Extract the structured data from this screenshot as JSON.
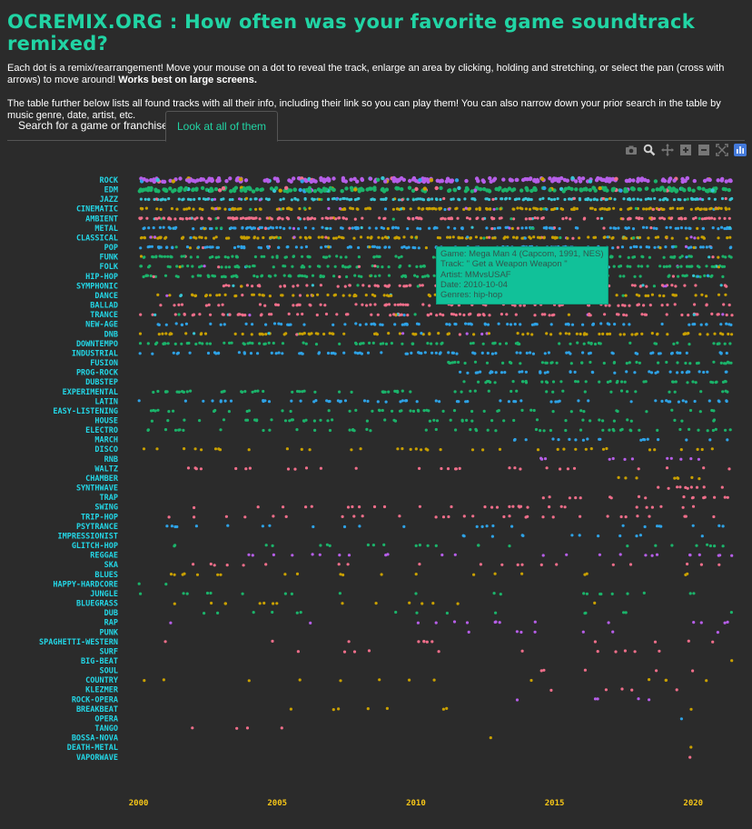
{
  "page": {
    "title": "OCREMIX.ORG : How often was your favorite game soundtrack remixed?",
    "intro1_text": "Each dot is a remix/rearrangement! Move your mouse on a dot to reveal the track, enlarge an area by clicking, holding and stretching, or select the pan (cross with arrows) to move around! ",
    "intro1_bold": "Works best on large screens.",
    "intro2": "The table further below lists all found tracks with all their info, including their link so you can play them! You can also narrow down your prior search in the table by music genre, date, artist, etc."
  },
  "tabs": [
    {
      "label": "Search for a game or franchise",
      "active": false
    },
    {
      "label": "Look at all of them",
      "active": true
    }
  ],
  "modebar": [
    "camera-icon",
    "zoom-icon",
    "pan-icon",
    "zoom-in-icon",
    "zoom-out-icon",
    "autoscale-icon",
    "plotly-logo-icon"
  ],
  "tooltip": {
    "game": "Game: Mega Man 4 (Capcom, 1991, NES)",
    "track": "Track: \" Get a Weapon Weapon \"",
    "artist": "Artist: MMvsUSAF",
    "date": "Date: 2010-10-04",
    "genres": "Genres: hip-hop"
  },
  "chart_data": {
    "type": "scatter",
    "xlabel": "",
    "ylabel": "",
    "x_ticks": [
      "2000",
      "2005",
      "2010",
      "2015",
      "2020"
    ],
    "xlim": [
      1999.85,
      2021.4
    ],
    "grid": false,
    "genre_colors": [
      "#36c4d4",
      "#36c4d4",
      "#f06e8a",
      "#c9a000",
      "#1bb36a",
      "#2ea2e6",
      "#b65ee8",
      "#c9a000",
      "#f06e8a",
      "#1bb36a"
    ],
    "categories": [
      "ROCK",
      "EDM",
      "JAZZ",
      "CINEMATIC",
      "AMBIENT",
      "METAL",
      "CLASSICAL",
      "POP",
      "FUNK",
      "FOLK",
      "HIP-HOP",
      "SYMPHONIC",
      "DANCE",
      "BALLAD",
      "TRANCE",
      "NEW-AGE",
      "DNB",
      "DOWNTEMPO",
      "INDUSTRIAL",
      "FUSION",
      "PROG-ROCK",
      "DUBSTEP",
      "EXPERIMENTAL",
      "LATIN",
      "EASY-LISTENING",
      "HOUSE",
      "ELECTRO",
      "MARCH",
      "DISCO",
      "RNB",
      "WALTZ",
      "CHAMBER",
      "SYNTHWAVE",
      "TRAP",
      "SWING",
      "TRIP-HOP",
      "PSYTRANCE",
      "IMPRESSIONIST",
      "GLITCH-HOP",
      "REGGAE",
      "SKA",
      "BLUES",
      "HAPPY-HARDCORE",
      "JUNGLE",
      "BLUEGRASS",
      "DUB",
      "RAP",
      "PUNK",
      "SPAGHETTI-WESTERN",
      "SURF",
      "BIG-BEAT",
      "SOUL",
      "COUNTRY",
      "KLEZMER",
      "ROCK-OPERA",
      "BREAKBEAT",
      "OPERA",
      "TANGO",
      "BOSSA-NOVA",
      "DEATH-METAL",
      "VAPORWAVE"
    ],
    "series": [
      {
        "genre": "ROCK",
        "color": "#b65ee8",
        "density": 1.0,
        "ranges": [
          [
            2000.0,
            2021.4
          ]
        ]
      },
      {
        "genre": "EDM",
        "color": "#1bb36a",
        "density": 1.0,
        "ranges": [
          [
            2000.0,
            2021.4
          ]
        ]
      },
      {
        "genre": "JAZZ",
        "color": "#36c4d4",
        "density": 0.8,
        "ranges": [
          [
            2000.0,
            2021.4
          ]
        ]
      },
      {
        "genre": "CINEMATIC",
        "color": "#c9a000",
        "density": 0.8,
        "ranges": [
          [
            2000.0,
            2021.4
          ]
        ]
      },
      {
        "genre": "AMBIENT",
        "color": "#f06e8a",
        "density": 0.7,
        "ranges": [
          [
            2000.0,
            2021.4
          ]
        ]
      },
      {
        "genre": "METAL",
        "color": "#2ea2e6",
        "density": 0.6,
        "ranges": [
          [
            2000.0,
            2021.4
          ]
        ]
      },
      {
        "genre": "CLASSICAL",
        "color": "#c9a000",
        "density": 0.7,
        "ranges": [
          [
            2000.0,
            2021.4
          ]
        ]
      },
      {
        "genre": "POP",
        "color": "#2ea2e6",
        "density": 0.6,
        "ranges": [
          [
            2000.0,
            2021.4
          ]
        ]
      },
      {
        "genre": "FUNK",
        "color": "#1bb36a",
        "density": 0.5,
        "ranges": [
          [
            2000.0,
            2021.4
          ]
        ]
      },
      {
        "genre": "FOLK",
        "color": "#1bb36a",
        "density": 0.5,
        "ranges": [
          [
            2000.0,
            2021.4
          ]
        ]
      },
      {
        "genre": "HIP-HOP",
        "color": "#1bb36a",
        "density": 0.5,
        "ranges": [
          [
            2000.0,
            2021.4
          ]
        ]
      },
      {
        "genre": "SYMPHONIC",
        "color": "#f06e8a",
        "density": 0.4,
        "ranges": [
          [
            2002.7,
            2021.4
          ]
        ]
      },
      {
        "genre": "DANCE",
        "color": "#c9a000",
        "density": 0.4,
        "ranges": [
          [
            2000.0,
            2021.4
          ]
        ]
      },
      {
        "genre": "BALLAD",
        "color": "#f06e8a",
        "density": 0.3,
        "ranges": [
          [
            2000.0,
            2021.4
          ]
        ]
      },
      {
        "genre": "TRANCE",
        "color": "#f06e8a",
        "density": 0.4,
        "ranges": [
          [
            2000.0,
            2021.4
          ]
        ]
      },
      {
        "genre": "NEW-AGE",
        "color": "#2ea2e6",
        "density": 0.35,
        "ranges": [
          [
            2000.5,
            2021.4
          ]
        ]
      },
      {
        "genre": "DNB",
        "color": "#c9a000",
        "density": 0.4,
        "ranges": [
          [
            2000.0,
            2021.4
          ]
        ]
      },
      {
        "genre": "DOWNTEMPO",
        "color": "#1bb36a",
        "density": 0.35,
        "ranges": [
          [
            2000.0,
            2021.4
          ]
        ]
      },
      {
        "genre": "INDUSTRIAL",
        "color": "#2ea2e6",
        "density": 0.35,
        "ranges": [
          [
            2000.0,
            2021.4
          ]
        ]
      },
      {
        "genre": "FUSION",
        "color": "#1bb36a",
        "density": 0.35,
        "ranges": [
          [
            2011.0,
            2021.4
          ]
        ]
      },
      {
        "genre": "PROG-ROCK",
        "color": "#2ea2e6",
        "density": 0.35,
        "ranges": [
          [
            2011.5,
            2021.4
          ]
        ]
      },
      {
        "genre": "DUBSTEP",
        "color": "#1bb36a",
        "density": 0.35,
        "ranges": [
          [
            2011.5,
            2021.4
          ]
        ]
      },
      {
        "genre": "EXPERIMENTAL",
        "color": "#1bb36a",
        "density": 0.25,
        "ranges": [
          [
            2000.5,
            2021.4
          ]
        ]
      },
      {
        "genre": "LATIN",
        "color": "#2ea2e6",
        "density": 0.25,
        "ranges": [
          [
            2000.0,
            2021.4
          ]
        ]
      },
      {
        "genre": "EASY-LISTENING",
        "color": "#1bb36a",
        "density": 0.2,
        "ranges": [
          [
            2000.2,
            2021.4
          ]
        ]
      },
      {
        "genre": "HOUSE",
        "color": "#1bb36a",
        "density": 0.2,
        "ranges": [
          [
            2000.4,
            2021.4
          ]
        ]
      },
      {
        "genre": "ELECTRO",
        "color": "#1bb36a",
        "density": 0.2,
        "ranges": [
          [
            2000.0,
            2021.4
          ]
        ]
      },
      {
        "genre": "MARCH",
        "color": "#2ea2e6",
        "density": 0.2,
        "ranges": [
          [
            2013.4,
            2021.4
          ]
        ]
      },
      {
        "genre": "DISCO",
        "color": "#c9a000",
        "density": 0.15,
        "ranges": [
          [
            2000.0,
            2021.4
          ]
        ]
      },
      {
        "genre": "RNB",
        "color": "#b65ee8",
        "density": 0.15,
        "ranges": [
          [
            2014.5,
            2021.4
          ]
        ]
      },
      {
        "genre": "WALTZ",
        "color": "#f06e8a",
        "density": 0.12,
        "ranges": [
          [
            2001.6,
            2021.4
          ]
        ]
      },
      {
        "genre": "CHAMBER",
        "color": "#c9a000",
        "density": 0.15,
        "ranges": [
          [
            2017.0,
            2021.4
          ]
        ]
      },
      {
        "genre": "SYNTHWAVE",
        "color": "#f06e8a",
        "density": 0.3,
        "ranges": [
          [
            2018.5,
            2021.4
          ]
        ]
      },
      {
        "genre": "TRAP",
        "color": "#f06e8a",
        "density": 0.2,
        "ranges": [
          [
            2014.5,
            2021.4
          ]
        ]
      },
      {
        "genre": "SWING",
        "color": "#f06e8a",
        "density": 0.12,
        "ranges": [
          [
            2000.8,
            2021.4
          ]
        ]
      },
      {
        "genre": "TRIP-HOP",
        "color": "#f06e8a",
        "density": 0.12,
        "ranges": [
          [
            2000.8,
            2021.4
          ]
        ]
      },
      {
        "genre": "PSYTRANCE",
        "color": "#2ea2e6",
        "density": 0.1,
        "ranges": [
          [
            2000.9,
            2021.4
          ]
        ]
      },
      {
        "genre": "IMPRESSIONIST",
        "color": "#2ea2e6",
        "density": 0.1,
        "ranges": [
          [
            2011.5,
            2021.4
          ]
        ]
      },
      {
        "genre": "GLITCH-HOP",
        "color": "#1bb36a",
        "density": 0.1,
        "ranges": [
          [
            2000.6,
            2021.4
          ]
        ]
      },
      {
        "genre": "REGGAE",
        "color": "#b65ee8",
        "density": 0.1,
        "ranges": [
          [
            2000.6,
            2021.4
          ]
        ]
      },
      {
        "genre": "SKA",
        "color": "#f06e8a",
        "density": 0.08,
        "ranges": [
          [
            2000.8,
            2021.4
          ]
        ]
      },
      {
        "genre": "BLUES",
        "color": "#c9a000",
        "density": 0.08,
        "ranges": [
          [
            2000.8,
            2021.4
          ]
        ]
      },
      {
        "genre": "HAPPY-HARDCORE",
        "color": "#1bb36a",
        "density": 0.1,
        "ranges": [
          [
            2000.0,
            2002.0
          ]
        ]
      },
      {
        "genre": "JUNGLE",
        "color": "#1bb36a",
        "density": 0.08,
        "ranges": [
          [
            2000.0,
            2021.4
          ]
        ]
      },
      {
        "genre": "BLUEGRASS",
        "color": "#c9a000",
        "density": 0.06,
        "ranges": [
          [
            2000.0,
            2021.4
          ]
        ]
      },
      {
        "genre": "DUB",
        "color": "#1bb36a",
        "density": 0.06,
        "ranges": [
          [
            2000.8,
            2021.4
          ]
        ]
      },
      {
        "genre": "RAP",
        "color": "#b65ee8",
        "density": 0.06,
        "ranges": [
          [
            2000.0,
            2021.4
          ]
        ]
      },
      {
        "genre": "PUNK",
        "color": "#b65ee8",
        "density": 0.06,
        "ranges": [
          [
            2011.5,
            2021.4
          ]
        ]
      },
      {
        "genre": "SPAGHETTI-WESTERN",
        "color": "#f06e8a",
        "density": 0.05,
        "ranges": [
          [
            2000.8,
            2021.4
          ]
        ]
      },
      {
        "genre": "SURF",
        "color": "#f06e8a",
        "density": 0.05,
        "ranges": [
          [
            2003.0,
            2021.4
          ]
        ]
      },
      {
        "genre": "BIG-BEAT",
        "color": "#c9a000",
        "density": 0.06,
        "ranges": [
          [
            2019.5,
            2021.4
          ]
        ]
      },
      {
        "genre": "SOUL",
        "color": "#f06e8a",
        "density": 0.05,
        "ranges": [
          [
            2013.0,
            2021.4
          ]
        ]
      },
      {
        "genre": "COUNTRY",
        "color": "#c9a000",
        "density": 0.05,
        "ranges": [
          [
            2000.0,
            2021.4
          ]
        ]
      },
      {
        "genre": "KLEZMER",
        "color": "#f06e8a",
        "density": 0.05,
        "ranges": [
          [
            2013.5,
            2021.4
          ]
        ]
      },
      {
        "genre": "ROCK-OPERA",
        "color": "#b65ee8",
        "density": 0.05,
        "ranges": [
          [
            2013.5,
            2021.4
          ]
        ]
      },
      {
        "genre": "BREAKBEAT",
        "color": "#c9a000",
        "density": 0.04,
        "ranges": [
          [
            2004.5,
            2021.4
          ]
        ]
      },
      {
        "genre": "OPERA",
        "color": "#2ea2e6",
        "density": 0.03,
        "ranges": [
          [
            2019.5,
            2020.0
          ]
        ]
      },
      {
        "genre": "TANGO",
        "color": "#f06e8a",
        "density": 0.03,
        "ranges": [
          [
            2000.8,
            2013.0
          ]
        ]
      },
      {
        "genre": "BOSSA-NOVA",
        "color": "#c9a000",
        "density": 0.03,
        "ranges": [
          [
            2012.5,
            2013.0
          ]
        ]
      },
      {
        "genre": "DEATH-METAL",
        "color": "#c9a000",
        "density": 0.03,
        "ranges": [
          [
            2019.5,
            2020.0
          ]
        ]
      },
      {
        "genre": "VAPORWAVE",
        "color": "#f06e8a",
        "density": 0.03,
        "ranges": [
          [
            2019.7,
            2020.1
          ]
        ]
      }
    ]
  }
}
